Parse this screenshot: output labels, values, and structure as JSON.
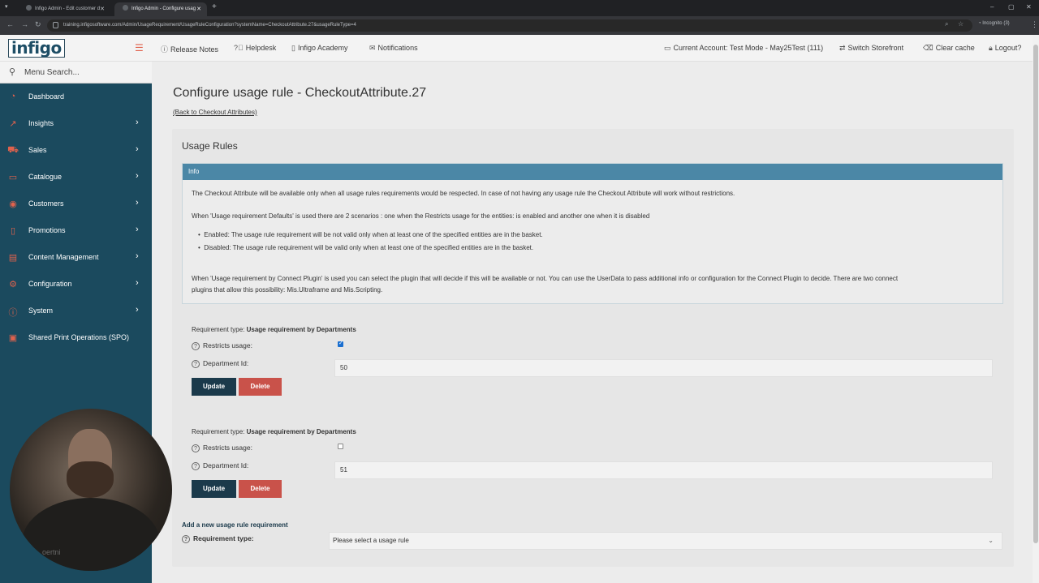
{
  "browser": {
    "tabs": [
      {
        "title": "Infigo Admin - Edit customer d"
      },
      {
        "title": "Infigo Admin - Configure usag"
      }
    ],
    "new_tab": "+",
    "url": "training.infigosoftware.com/Admin/UsageRequirement/UsageRuleConfiguration?systemName=CheckoutAttribute.27&usageRuleType=4",
    "incognito_label": "Incognito (3)"
  },
  "header": {
    "logo": "infigo",
    "links": [
      {
        "label": "Release Notes",
        "icon": "info-icon"
      },
      {
        "label": "Helpdesk",
        "icon": "help-icon"
      },
      {
        "label": "Infigo Academy",
        "icon": "book-icon"
      },
      {
        "label": "Notifications",
        "icon": "mail-icon"
      }
    ],
    "right_links": [
      {
        "label": "Current Account: Test Mode - May25Test (111)",
        "icon": "monitor-icon"
      },
      {
        "label": "Switch Storefront",
        "icon": "switch-icon"
      },
      {
        "label": "Clear cache",
        "icon": "eraser-icon"
      },
      {
        "label": "Logout?",
        "icon": "lock-icon"
      }
    ]
  },
  "sidebar": {
    "search_placeholder": "Menu Search...",
    "items": [
      {
        "label": "Dashboard",
        "icon": "dashboard-icon",
        "has_children": false
      },
      {
        "label": "Insights",
        "icon": "chart-icon",
        "has_children": true
      },
      {
        "label": "Sales",
        "icon": "cart-icon",
        "has_children": true
      },
      {
        "label": "Catalogue",
        "icon": "folder-icon",
        "has_children": true
      },
      {
        "label": "Customers",
        "icon": "user-icon",
        "has_children": true
      },
      {
        "label": "Promotions",
        "icon": "tag-icon",
        "has_children": true
      },
      {
        "label": "Content Management",
        "icon": "content-icon",
        "has_children": true
      },
      {
        "label": "Configuration",
        "icon": "gear-icon",
        "has_children": true
      },
      {
        "label": "System",
        "icon": "system-icon",
        "has_children": true
      },
      {
        "label": "Shared Print Operations (SPO)",
        "icon": "print-icon",
        "has_children": false
      }
    ]
  },
  "webcam": {
    "shirt_text": "oertni"
  },
  "main": {
    "title": "Configure usage rule - CheckoutAttribute.27",
    "back_link": "(Back to Checkout Attributes)",
    "card_title": "Usage Rules",
    "info": {
      "heading": "Info",
      "p1": "The Checkout Attribute will be available only when all usage rules requirements would be respected. In case of not having any usage rule the Checkout Attribute will work without restrictions.",
      "p2": "When 'Usage requirement Defaults' is used there are 2 scenarios : one when the Restricts usage for the entities: is enabled and another one when it is disabled",
      "bullet1": "Enabled: The usage rule requirement will be not valid only when at least one of the specified entities are in the basket.",
      "bullet2": "Disabled: The usage rule requirement will be valid only when at least one of the specified entities are in the basket.",
      "p3a": "When 'Usage requirement by Connect Plugin' is used you can select the plugin that will decide if this will be available or not. You can use the UserData to pass additional info or configuration for the Connect Plugin to decide. There are two connect",
      "p3b": "plugins that allow this possibility: Mis.Ultraframe and Mis.Scripting."
    },
    "requirements": [
      {
        "type_prefix": "Requirement type:",
        "type_value": "Usage requirement by Departments",
        "restricts_label": "Restricts usage:",
        "restricts_checked": true,
        "dept_label": "Department Id:",
        "dept_value": "50",
        "update_label": "Update",
        "delete_label": "Delete"
      },
      {
        "type_prefix": "Requirement type:",
        "type_value": "Usage requirement by Departments",
        "restricts_label": "Restricts usage:",
        "restricts_checked": false,
        "dept_label": "Department Id:",
        "dept_value": "51",
        "update_label": "Update",
        "delete_label": "Delete"
      }
    ],
    "add_new": {
      "title": "Add a new usage rule requirement",
      "label": "Requirement type:",
      "select_value": "Please select a usage rule"
    }
  },
  "colors": {
    "sidebar_bg": "#1b4a5e",
    "accent": "#e0624d",
    "info_header": "#4b87a6",
    "update_btn": "#1b3a4b",
    "delete_btn": "#c9524a"
  }
}
